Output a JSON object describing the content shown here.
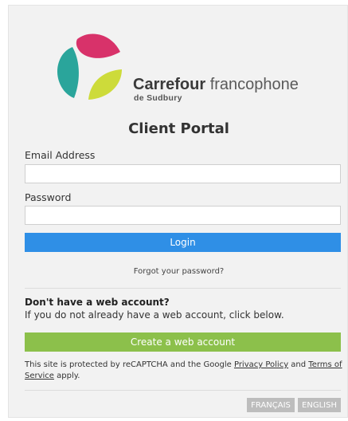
{
  "brand": {
    "name_bold": "Carrefour",
    "name_light": "francophone",
    "sub": "de Sudbury",
    "colors": {
      "pink": "#d8326a",
      "teal": "#2aa59b",
      "lime": "#cddb3a"
    }
  },
  "page_title": "Client Portal",
  "form": {
    "email_label": "Email Address",
    "email_value": "",
    "password_label": "Password",
    "password_value": "",
    "login_label": "Login",
    "forgot_label": "Forgot your password?"
  },
  "signup": {
    "heading": "Don't have a web account?",
    "text": "If you do not already have a web account, click below.",
    "button_label": "Create a web account"
  },
  "recaptcha": {
    "prefix": "This site is protected by reCAPTCHA and the Google ",
    "privacy_label": "Privacy Policy",
    "middle": " and ",
    "terms_label": "Terms of Service",
    "suffix": " apply."
  },
  "languages": [
    "FRANÇAIS",
    "ENGLISH"
  ],
  "colors": {
    "login_button": "#2f8fe6",
    "create_button": "#8cc04b",
    "language_button": "#bdbdbd"
  }
}
